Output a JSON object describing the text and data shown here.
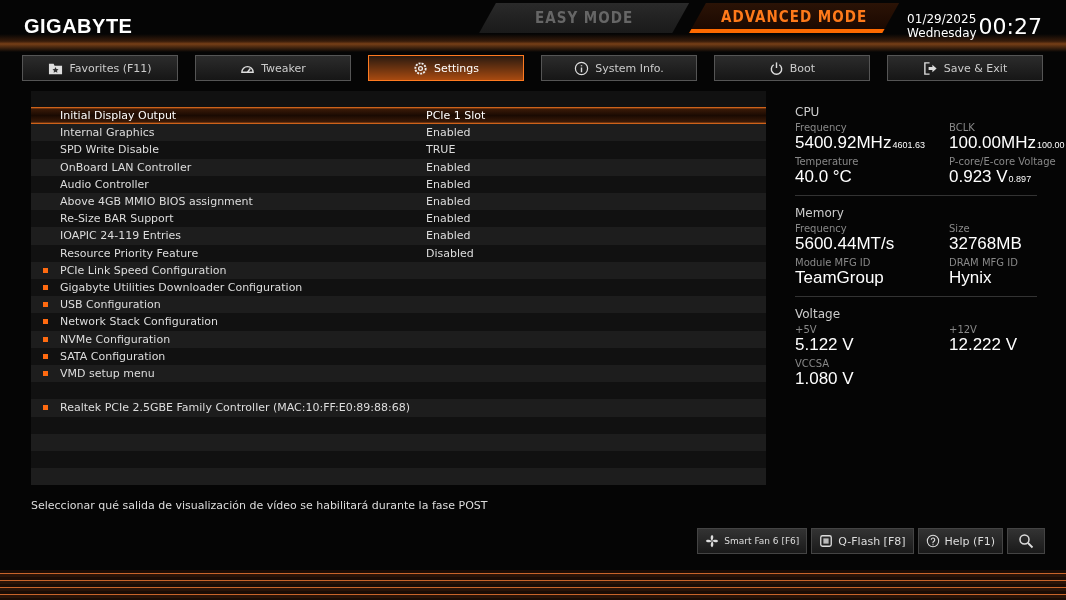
{
  "header": {
    "logo": "GIGABYTE",
    "modes": [
      {
        "label": "EASY MODE",
        "selected": false
      },
      {
        "label": "ADVANCED MODE",
        "selected": true
      }
    ],
    "date": "01/29/2025",
    "weekday": "Wednesday",
    "time": "00:27"
  },
  "tabs": [
    {
      "label": "Favorites (F11)",
      "selected": false
    },
    {
      "label": "Tweaker",
      "selected": false
    },
    {
      "label": "Settings",
      "selected": true
    },
    {
      "label": "System Info.",
      "selected": false
    },
    {
      "label": "Boot",
      "selected": false
    },
    {
      "label": "Save & Exit",
      "selected": false
    }
  ],
  "settings": [
    {
      "kind": "option",
      "label": "Initial Display Output",
      "value": "PCIe 1 Slot",
      "selected": true
    },
    {
      "kind": "option",
      "label": "Internal Graphics",
      "value": "Enabled",
      "selected": false
    },
    {
      "kind": "option",
      "label": "SPD Write Disable",
      "value": "TRUE",
      "selected": false
    },
    {
      "kind": "option",
      "label": "OnBoard LAN Controller",
      "value": "Enabled",
      "selected": false
    },
    {
      "kind": "option",
      "label": "Audio Controller",
      "value": "Enabled",
      "selected": false
    },
    {
      "kind": "option",
      "label": "Above 4GB MMIO BIOS assignment",
      "value": "Enabled",
      "selected": false
    },
    {
      "kind": "option",
      "label": "Re-Size BAR Support",
      "value": "Enabled",
      "selected": false
    },
    {
      "kind": "option",
      "label": "IOAPIC 24-119 Entries",
      "value": "Enabled",
      "selected": false
    },
    {
      "kind": "option",
      "label": "Resource Priority Feature",
      "value": "Disabled",
      "selected": false
    },
    {
      "kind": "submenu",
      "label": "PCIe Link Speed Configuration",
      "selected": false
    },
    {
      "kind": "submenu",
      "label": "Gigabyte Utilities Downloader Configuration",
      "selected": false
    },
    {
      "kind": "submenu",
      "label": "USB Configuration",
      "selected": false
    },
    {
      "kind": "submenu",
      "label": "Network Stack Configuration",
      "selected": false
    },
    {
      "kind": "submenu",
      "label": "NVMe Configuration",
      "selected": false
    },
    {
      "kind": "submenu",
      "label": "SATA Configuration",
      "selected": false
    },
    {
      "kind": "submenu",
      "label": "VMD setup menu",
      "selected": false
    },
    {
      "kind": "blank"
    },
    {
      "kind": "submenu",
      "label": "Realtek PCIe 2.5GBE Family Controller (MAC:10:FF:E0:89:88:68)",
      "selected": false
    }
  ],
  "description": "Seleccionar qué salida de visualización de vídeo se habilitará durante la fase POST",
  "monitor": [
    {
      "title": "CPU",
      "items": [
        {
          "label": "Frequency",
          "value": "5400.92MHz",
          "sub": "4601.63"
        },
        {
          "label": "BCLK",
          "value": "100.00MHz",
          "sub": "100.00"
        },
        {
          "label": "Temperature",
          "value": "40.0 °C"
        },
        {
          "label": "P-core/E-core Voltage",
          "value": "0.923 V",
          "sub": "0.897"
        }
      ]
    },
    {
      "title": "Memory",
      "items": [
        {
          "label": "Frequency",
          "value": "5600.44MT/s"
        },
        {
          "label": "Size",
          "value": "32768MB"
        },
        {
          "label": "Module MFG ID",
          "value": "TeamGroup"
        },
        {
          "label": "DRAM MFG ID",
          "value": "Hynix"
        }
      ]
    },
    {
      "title": "Voltage",
      "items": [
        {
          "label": "+5V",
          "value": "5.122 V"
        },
        {
          "label": "+12V",
          "value": "12.222 V"
        },
        {
          "label": "VCCSA",
          "value": "1.080 V"
        }
      ]
    }
  ],
  "footer_buttons": [
    {
      "kind": "fan",
      "label": "Smart Fan 6 [F6]"
    },
    {
      "kind": "flash",
      "label": "Q-Flash [F8]"
    },
    {
      "kind": "help",
      "label": "Help (F1)"
    },
    {
      "kind": "search"
    }
  ]
}
